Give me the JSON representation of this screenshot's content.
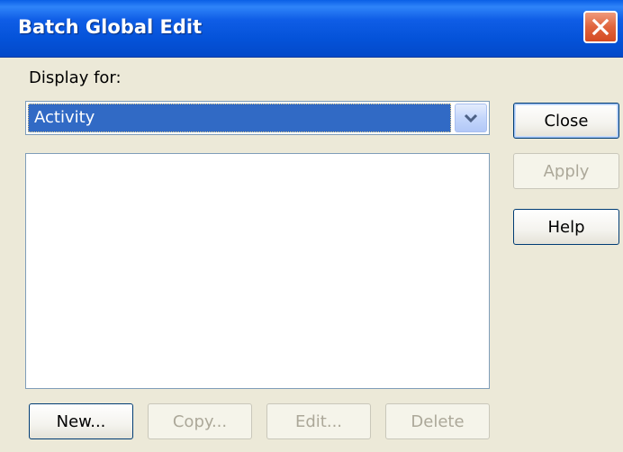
{
  "window": {
    "title": "Batch Global Edit"
  },
  "display_for": {
    "label": "Display for:",
    "selected": "Activity"
  },
  "list": {
    "items": []
  },
  "side_buttons": {
    "close": "Close",
    "apply": "Apply",
    "help": "Help"
  },
  "bottom_buttons": {
    "new": "New...",
    "copy": "Copy...",
    "edit": "Edit...",
    "delete": "Delete"
  },
  "colors": {
    "titlebar": "#0452d8",
    "selection": "#316ac5",
    "close_button": "#e0643d",
    "dialog_bg": "#ece9d8"
  }
}
